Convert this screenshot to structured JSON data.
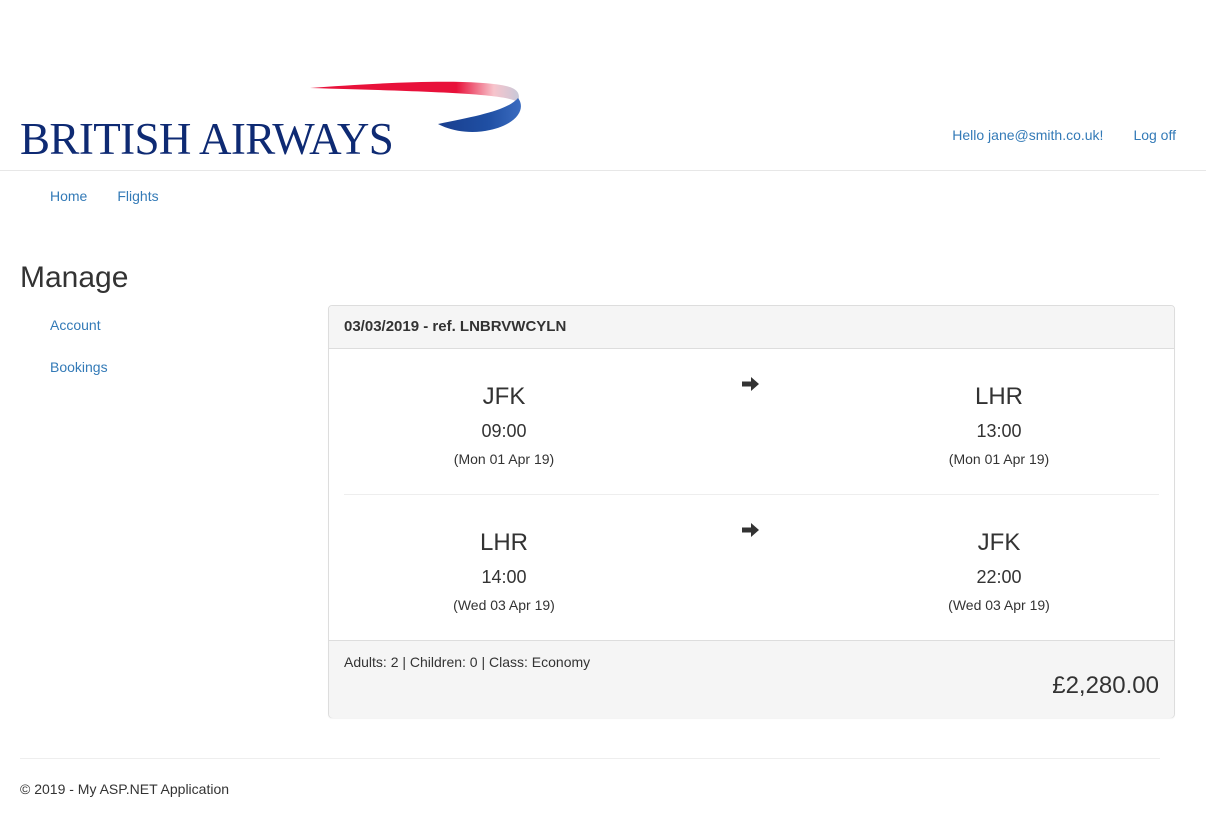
{
  "brand": {
    "logo_text": "BRITISH AIRWAYS",
    "colors": {
      "navy": "#0e2a73",
      "red": "#e8113a",
      "blue": "#1f4fa3"
    }
  },
  "user_nav": {
    "greeting": "Hello jane@smith.co.uk!",
    "logoff": "Log off"
  },
  "main_nav": [
    {
      "label": "Home"
    },
    {
      "label": "Flights"
    }
  ],
  "page": {
    "title": "Manage"
  },
  "side_nav": [
    {
      "label": "Account"
    },
    {
      "label": "Bookings"
    }
  ],
  "booking": {
    "heading": "03/03/2019 - ref. LNBRVWCYLN",
    "legs": [
      {
        "from": {
          "code": "JFK",
          "time": "09:00",
          "date": "(Mon 01 Apr 19)"
        },
        "to": {
          "code": "LHR",
          "time": "13:00",
          "date": "(Mon 01 Apr 19)"
        },
        "arrow_icon": "arrow-right-icon"
      },
      {
        "from": {
          "code": "LHR",
          "time": "14:00",
          "date": "(Wed 03 Apr 19)"
        },
        "to": {
          "code": "JFK",
          "time": "22:00",
          "date": "(Wed 03 Apr 19)"
        },
        "arrow_icon": "arrow-right-icon"
      }
    ],
    "summary": "Adults: 2 | Children: 0 | Class: Economy",
    "price": "£2,280.00"
  },
  "footer": {
    "copyright": "© 2019 - My ASP.NET Application"
  },
  "colors": {
    "link": "#337ab7",
    "panel_bg": "#f5f5f5",
    "border": "#dddddd"
  }
}
